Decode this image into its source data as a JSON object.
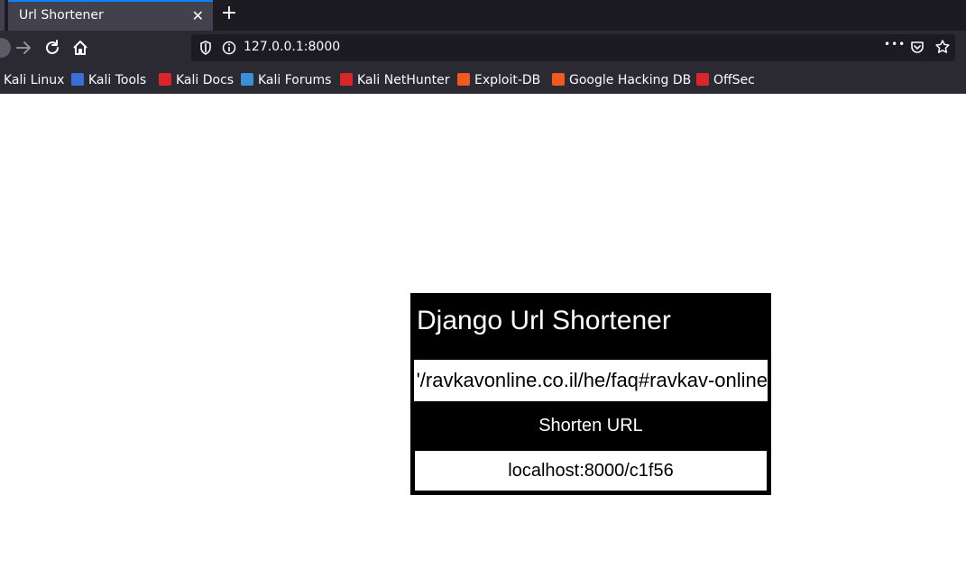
{
  "browser": {
    "tab_title": "Url Shortener",
    "tab_close": "✕",
    "new_tab": "+",
    "url": "127.0.0.1:8000",
    "menu_dots": "•••",
    "bookmarks": [
      {
        "label": "Kali Linux",
        "icon": "kali-linux-icon",
        "color": "#4aa3df"
      },
      {
        "label": "Kali Tools",
        "icon": "kali-tools-icon",
        "color": "#3b6fd8"
      },
      {
        "label": "Kali Docs",
        "icon": "kali-docs-icon",
        "color": "#d9262b"
      },
      {
        "label": "Kali Forums",
        "icon": "kali-forums-icon",
        "color": "#3b8fd8"
      },
      {
        "label": "Kali NetHunter",
        "icon": "kali-nethunter-icon",
        "color": "#d9262b"
      },
      {
        "label": "Exploit-DB",
        "icon": "exploit-db-icon",
        "color": "#f05a22"
      },
      {
        "label": "Google Hacking DB",
        "icon": "google-hacking-db-icon",
        "color": "#f05a22"
      },
      {
        "label": "OffSec",
        "icon": "offsec-icon",
        "color": "#d9262b"
      }
    ]
  },
  "app": {
    "title": "Django Url Shortener",
    "input_value": "'/ravkavonline.co.il/he/faq#ravkav-online",
    "button_label": "Shorten URL",
    "result": "localhost:8000/c1f56"
  }
}
